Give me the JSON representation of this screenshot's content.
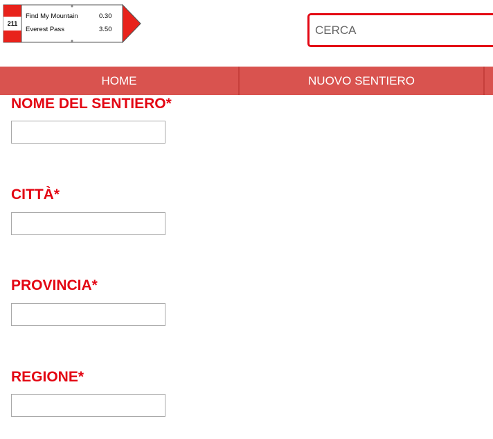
{
  "header": {
    "logo": {
      "number": "211",
      "rows": [
        {
          "name": "Find My Mountain",
          "value": "0.30"
        },
        {
          "name": "Everest Pass",
          "value": "3.50"
        }
      ],
      "colors": {
        "red": "#e8221b",
        "border": "#555555"
      }
    },
    "search": {
      "placeholder": "CERCA",
      "value": ""
    }
  },
  "nav": {
    "items": [
      {
        "label": "HOME"
      },
      {
        "label": "NUOVO SENTIERO"
      },
      {
        "label": ""
      }
    ]
  },
  "form": {
    "fields": [
      {
        "label": "NOME DEL SENTIERO*",
        "value": ""
      },
      {
        "label": "CITTÀ*",
        "value": ""
      },
      {
        "label": "PROVINCIA*",
        "value": ""
      },
      {
        "label": "REGIONE*",
        "value": ""
      }
    ]
  },
  "colors": {
    "accent": "#e30613",
    "nav_bg": "#d9534f",
    "nav_divider": "#c63f3b",
    "input_border": "#a9a9a9"
  }
}
